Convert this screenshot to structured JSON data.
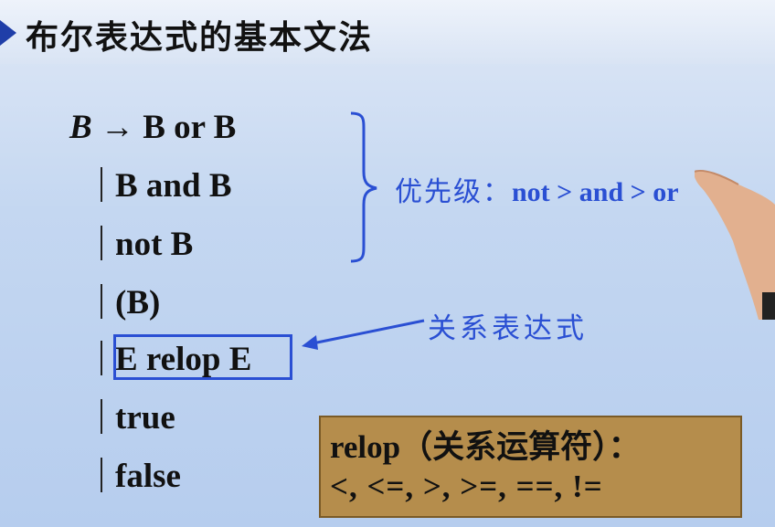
{
  "title": "布尔表达式的基本文法",
  "grammar": {
    "head_symbol": "B",
    "arrow": "→",
    "rule1": "B or B",
    "alt2": "B and B",
    "alt3": "not B",
    "alt4": "(B)",
    "alt5": "E relop E",
    "alt6": "true",
    "alt7": "false"
  },
  "priority_note": {
    "label": "优先级：",
    "expr": "not > and > or"
  },
  "relational_label": "关系表达式",
  "relop_box": {
    "title_prefix": "relop",
    "title_cn": "（关系运算符）：",
    "operators": "<, <=, >, >=, ==, !="
  },
  "colors": {
    "accent": "#2a4fd3",
    "note_bg": "#b58d4c",
    "marker": "#1f3ea8"
  }
}
